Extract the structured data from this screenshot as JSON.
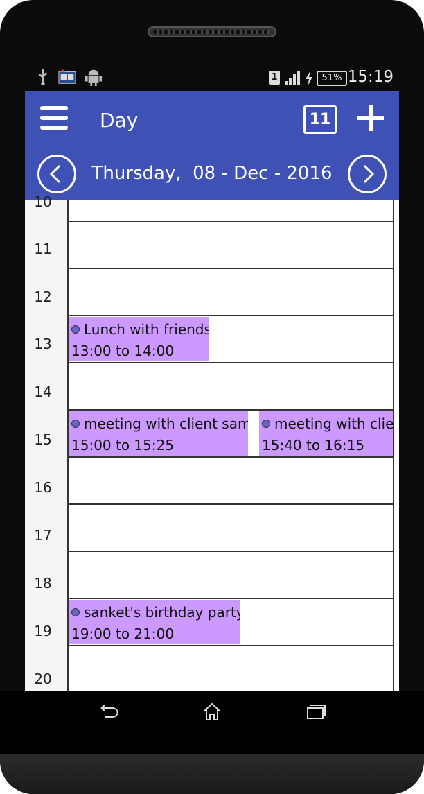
{
  "statusbar": {
    "time": "15:19",
    "battery": "51%",
    "sim": "1",
    "icons": [
      "usb-icon",
      "book-icon",
      "android-icon",
      "sim-icon",
      "signal-icon",
      "charging-icon",
      "battery-icon"
    ]
  },
  "appbar": {
    "title": "Day",
    "today_label": "11",
    "icons": {
      "menu": "hamburger-icon",
      "add": "plus-icon"
    }
  },
  "datebar": {
    "date": "Thursday,  08 - Dec - 2016",
    "prev_icon": "chevron-left-icon",
    "next_icon": "chevron-right-icon"
  },
  "hours": [
    "10",
    "11",
    "12",
    "13",
    "14",
    "15",
    "16",
    "17",
    "18",
    "19",
    "20"
  ],
  "events": [
    {
      "title": "Lunch with friends",
      "time": "13:00 to 14:00"
    },
    {
      "title": "meeting with client samir",
      "time": "15:00 to 15:25"
    },
    {
      "title": "meeting with client",
      "time": "15:40 to 16:15"
    },
    {
      "title": "sanket's birthday party",
      "time": "19:00 to 21:00"
    }
  ],
  "colors": {
    "primary": "#3f51b5",
    "event": "#cc99ff",
    "event_dot": "#6666cc"
  },
  "navbar": {
    "icons": [
      "back-icon",
      "home-icon",
      "recents-icon"
    ]
  }
}
